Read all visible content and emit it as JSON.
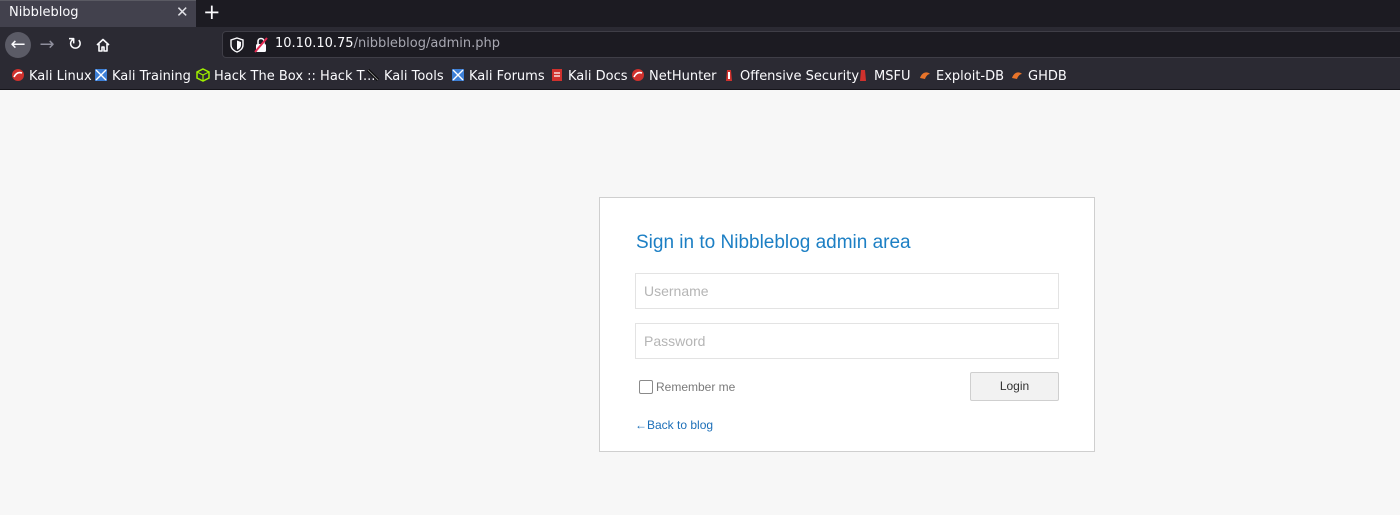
{
  "tab": {
    "title": "Nibbleblog",
    "close_glyph": "✕",
    "new_tab_glyph": "+"
  },
  "nav": {
    "back_glyph": "←",
    "forward_glyph": "→",
    "reload_glyph": "↻",
    "home_icon": "home-icon"
  },
  "url": {
    "host": "10.10.10.75",
    "path": "/nibbleblog/admin.php"
  },
  "bookmarks": [
    {
      "label": "Kali Linux",
      "icon": "kali-dragon-icon",
      "color": "#d0312d"
    },
    {
      "label": "Kali Training",
      "icon": "kali-training-icon",
      "color": "#3d7fd6"
    },
    {
      "label": "Hack The Box :: Hack T...",
      "icon": "hackthebox-cube-icon",
      "color": "#9fef00"
    },
    {
      "label": "Kali Tools",
      "icon": "kali-tools-icon",
      "color": "#111111"
    },
    {
      "label": "Kali Forums",
      "icon": "kali-forums-icon",
      "color": "#3d7fd6"
    },
    {
      "label": "Kali Docs",
      "icon": "kali-docs-icon",
      "color": "#d0312d"
    },
    {
      "label": "NetHunter",
      "icon": "nethunter-icon",
      "color": "#d0312d"
    },
    {
      "label": "Offensive Security",
      "icon": "offsec-icon",
      "color": "#d0312d"
    },
    {
      "label": "MSFU",
      "icon": "msfu-icon",
      "color": "#d0312d"
    },
    {
      "label": "Exploit-DB",
      "icon": "exploitdb-icon",
      "color": "#e8742a"
    },
    {
      "label": "GHDB",
      "icon": "ghdb-icon",
      "color": "#e8742a"
    }
  ],
  "login": {
    "title": "Sign in to Nibbleblog admin area",
    "username_placeholder": "Username",
    "password_placeholder": "Password",
    "remember_label": "Remember me",
    "login_button": "Login",
    "back_link": "←Back to blog"
  },
  "colors": {
    "title_blue": "#1c7fc4",
    "link_blue": "#1c6fb8"
  }
}
